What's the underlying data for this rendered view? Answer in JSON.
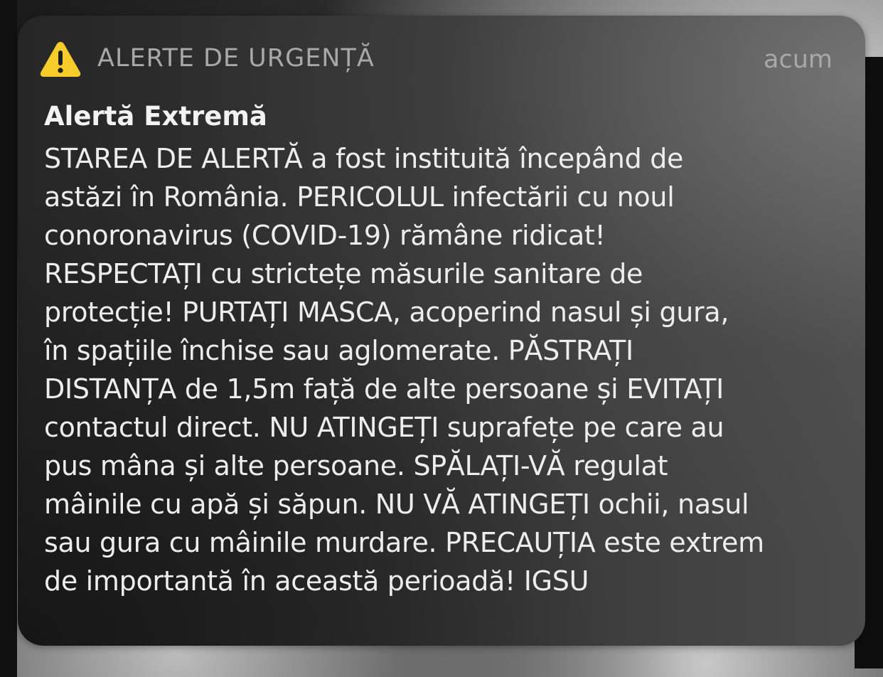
{
  "notification": {
    "app_name": "ALERTE DE URGENȚĂ",
    "timestamp": "acum",
    "icon": "warning-triangle-icon",
    "icon_color": "#f5cc2a",
    "title": "Alertă Extremă",
    "body_lines": [
      "STAREA DE ALERTĂ a fost instituită începând de",
      "astăzi în România. PERICOLUL infectării cu noul",
      "conoronavirus (COVID-19) rămâne ridicat!",
      "RESPECTAȚI cu strictețe măsurile sanitare de",
      "protecție! PURTAȚI MASCA, acoperind nasul și gura,",
      "în spațiile închise sau aglomerate. PĂSTRAȚI",
      "DISTANȚA de 1,5m față de alte persoane și EVITAȚI",
      "contactul direct. NU ATINGEȚI suprafețe pe care au",
      "pus mâna și alte persoane. SPĂLAȚI-VĂ regulat",
      "mâinile cu apă și săpun. NU VĂ ATINGEȚI ochii, nasul",
      "sau gura cu mâinile murdare. PRECAUȚIA este extrem",
      "de importantă în această perioadă! IGSU"
    ]
  }
}
